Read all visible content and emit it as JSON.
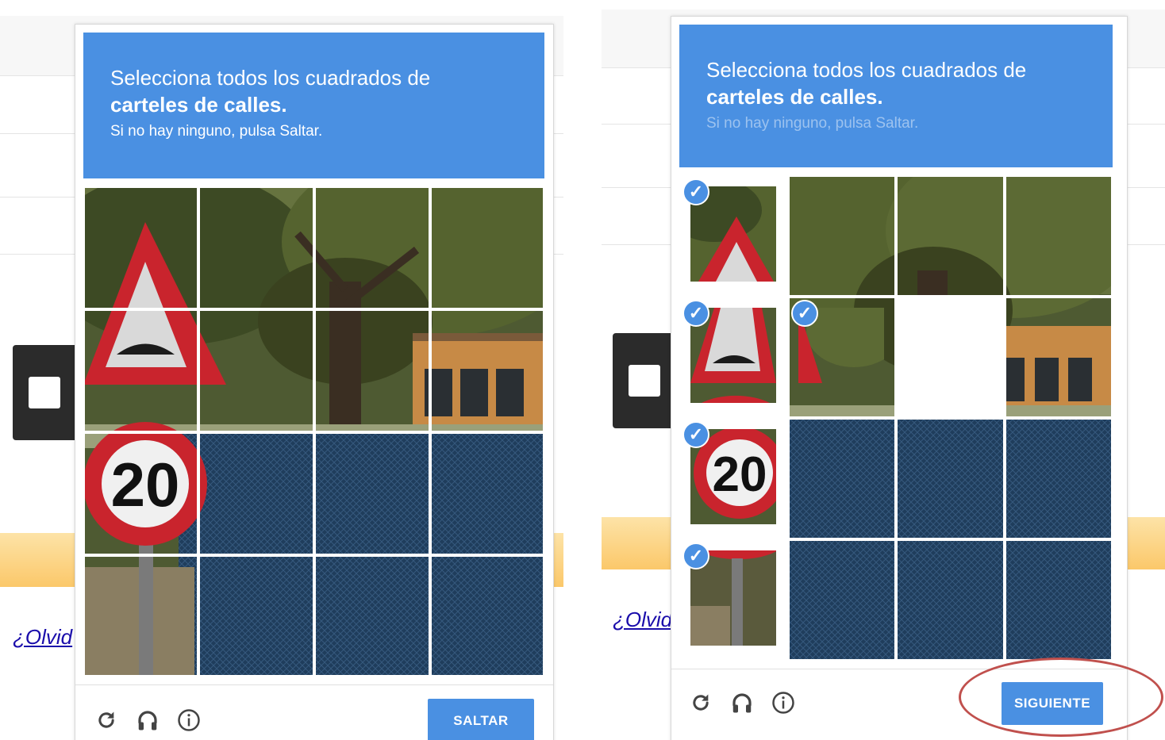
{
  "left": {
    "header": {
      "line1": "Selecciona todos los cuadrados de",
      "line2": "carteles de calles.",
      "line3": "Si no hay ninguno, pulsa Saltar."
    },
    "button_label": "SALTAR",
    "forgot_text": "¿Olvid"
  },
  "right": {
    "header": {
      "line1": "Selecciona todos los cuadrados de",
      "line2": "carteles de calles.",
      "line3": "Si no hay ninguno, pulsa Saltar."
    },
    "button_label": "SIGUIENTE",
    "forgot_text": "¿Olvid",
    "selected_tiles": [
      "r1c1",
      "r2c1",
      "r2c2",
      "r3c1",
      "r4c1"
    ]
  },
  "sign_number": "20",
  "icons": [
    "reload-icon",
    "headphones-icon",
    "info-icon",
    "check-icon"
  ],
  "colors": {
    "header_blue": "#4a90e2",
    "button_blue": "#4a90e2",
    "annotation_red": "#c0504d",
    "highlight_orange": "#fbc86a"
  }
}
